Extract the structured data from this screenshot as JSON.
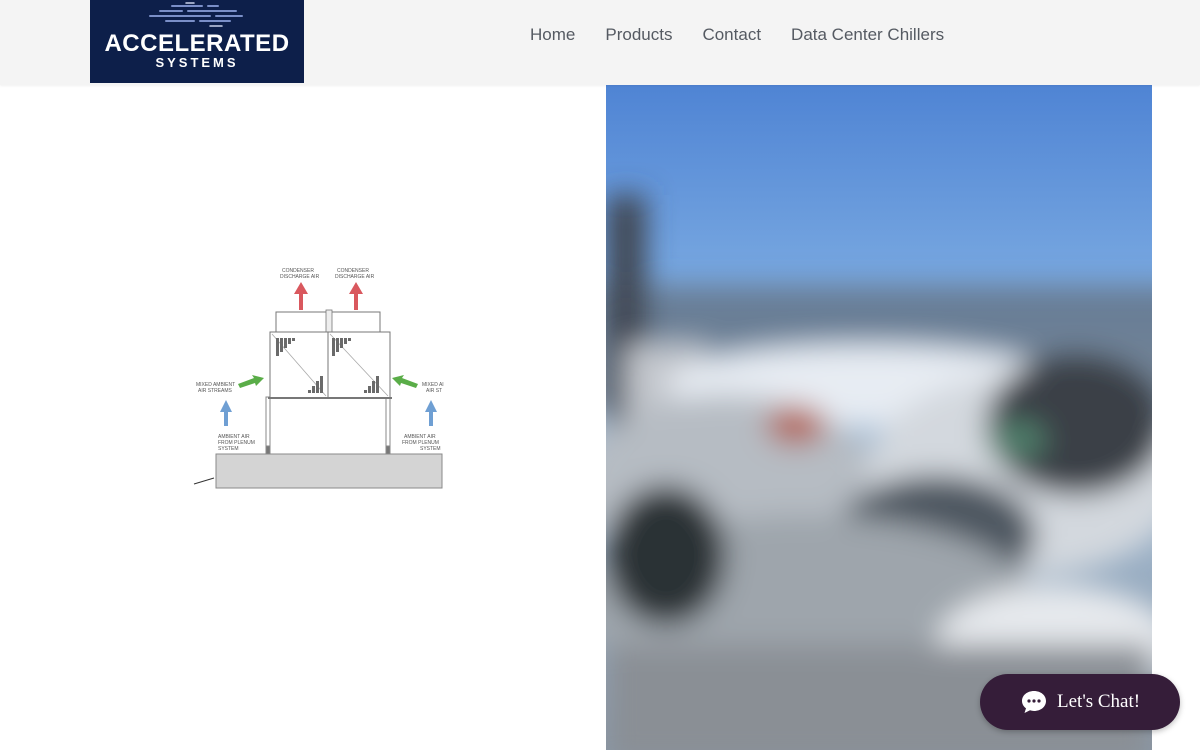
{
  "brand": {
    "name_line1": "ACCELERATED",
    "name_line2": "SYSTEMS",
    "background_color": "#0d1f4a",
    "accent_color": "#7a8fc8"
  },
  "nav": {
    "items": [
      {
        "label": "Home"
      },
      {
        "label": "Products"
      },
      {
        "label": "Contact"
      },
      {
        "label": "Data Center Chillers"
      }
    ]
  },
  "diagram": {
    "labels": {
      "discharge_left": [
        "CONDENSER",
        "DISCHARGE AIR"
      ],
      "discharge_right": [
        "CONDENSER",
        "DISCHARGE AIR"
      ],
      "mixed_left": [
        "MIXED AMBIENT",
        "AIR STREAMS"
      ],
      "mixed_right": [
        "MIXED AI",
        "AIR ST"
      ],
      "ambient_left": [
        "AMBIENT AIR",
        "FROM PLENUM",
        "SYSTEM"
      ],
      "ambient_right": [
        "AMBIENT AIR",
        "FROM PLENUM",
        "SYSTEM"
      ]
    },
    "colors": {
      "discharge_arrow": "#d9585e",
      "mixed_arrow": "#5aad48",
      "ambient_arrow": "#6f9fd3"
    }
  },
  "photo": {
    "description_icon": "blurred-outdoor-photo"
  },
  "chat": {
    "label": "Let's Chat!",
    "icon": "chat-bubble-icon",
    "background_color": "#351d39"
  }
}
